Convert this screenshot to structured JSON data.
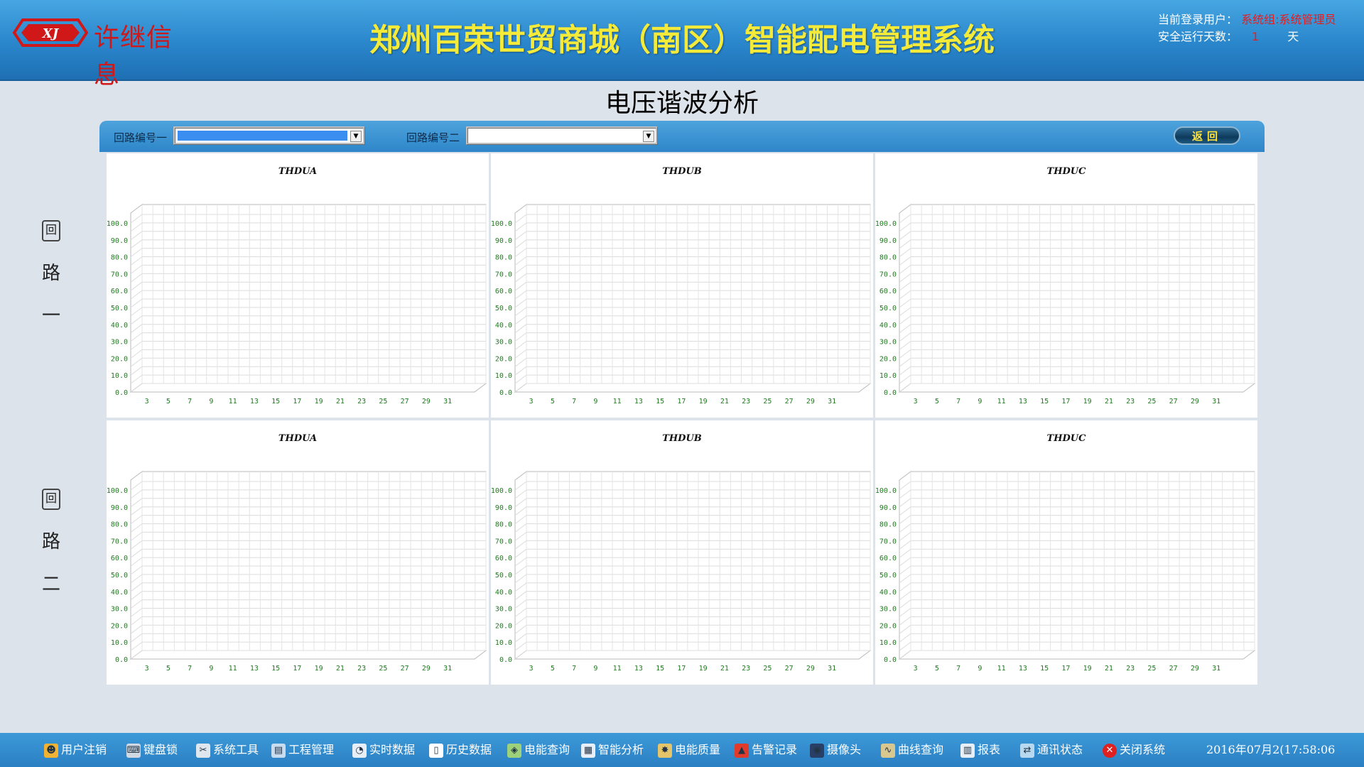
{
  "header": {
    "logo_text": "许继信息",
    "title": "郑州百荣世贸商城（南区）智能配电管理系统",
    "login_label": "当前登录用户：",
    "login_user": "系统组:系统管理员",
    "safe_days_label": "安全运行天数：",
    "safe_days_value": "1",
    "safe_days_unit": "天"
  },
  "page_title": "电压谐波分析",
  "toolbar": {
    "circuit1_label": "回路编号一",
    "circuit2_label": "回路编号二",
    "back_label": "返回"
  },
  "side_labels": {
    "circuit1": [
      "回",
      "路",
      "一"
    ],
    "circuit2": [
      "回",
      "路",
      "二"
    ]
  },
  "chart_data": [
    {
      "type": "bar",
      "title": "THDUA",
      "categories": [
        "3",
        "5",
        "7",
        "9",
        "11",
        "13",
        "15",
        "17",
        "19",
        "21",
        "23",
        "25",
        "27",
        "29",
        "31"
      ],
      "values": [],
      "ylim": [
        0,
        100
      ],
      "yticks": [
        "0.0",
        "10.0",
        "20.0",
        "30.0",
        "40.0",
        "50.0",
        "60.0",
        "70.0",
        "80.0",
        "90.0",
        "100.0"
      ],
      "grid": true
    },
    {
      "type": "bar",
      "title": "THDUB",
      "categories": [
        "3",
        "5",
        "7",
        "9",
        "11",
        "13",
        "15",
        "17",
        "19",
        "21",
        "23",
        "25",
        "27",
        "29",
        "31"
      ],
      "values": [],
      "ylim": [
        0,
        100
      ],
      "yticks": [
        "0.0",
        "10.0",
        "20.0",
        "30.0",
        "40.0",
        "50.0",
        "60.0",
        "70.0",
        "80.0",
        "90.0",
        "100.0"
      ],
      "grid": true
    },
    {
      "type": "bar",
      "title": "THDUC",
      "categories": [
        "3",
        "5",
        "7",
        "9",
        "11",
        "13",
        "15",
        "17",
        "19",
        "21",
        "23",
        "25",
        "27",
        "29",
        "31"
      ],
      "values": [],
      "ylim": [
        0,
        100
      ],
      "yticks": [
        "0.0",
        "10.0",
        "20.0",
        "30.0",
        "40.0",
        "50.0",
        "60.0",
        "70.0",
        "80.0",
        "90.0",
        "100.0"
      ],
      "grid": true
    },
    {
      "type": "bar",
      "title": "THDUA",
      "categories": [
        "3",
        "5",
        "7",
        "9",
        "11",
        "13",
        "15",
        "17",
        "19",
        "21",
        "23",
        "25",
        "27",
        "29",
        "31"
      ],
      "values": [],
      "ylim": [
        0,
        100
      ],
      "yticks": [
        "0.0",
        "10.0",
        "20.0",
        "30.0",
        "40.0",
        "50.0",
        "60.0",
        "70.0",
        "80.0",
        "90.0",
        "100.0"
      ],
      "grid": true
    },
    {
      "type": "bar",
      "title": "THDUB",
      "categories": [
        "3",
        "5",
        "7",
        "9",
        "11",
        "13",
        "15",
        "17",
        "19",
        "21",
        "23",
        "25",
        "27",
        "29",
        "31"
      ],
      "values": [],
      "ylim": [
        0,
        100
      ],
      "yticks": [
        "0.0",
        "10.0",
        "20.0",
        "30.0",
        "40.0",
        "50.0",
        "60.0",
        "70.0",
        "80.0",
        "90.0",
        "100.0"
      ],
      "grid": true
    },
    {
      "type": "bar",
      "title": "THDUC",
      "categories": [
        "3",
        "5",
        "7",
        "9",
        "11",
        "13",
        "15",
        "17",
        "19",
        "21",
        "23",
        "25",
        "27",
        "29",
        "31"
      ],
      "values": [],
      "ylim": [
        0,
        100
      ],
      "yticks": [
        "0.0",
        "10.0",
        "20.0",
        "30.0",
        "40.0",
        "50.0",
        "60.0",
        "70.0",
        "80.0",
        "90.0",
        "100.0"
      ],
      "grid": true
    }
  ],
  "bottom_nav": [
    {
      "label": "用户注销",
      "icon": "user-logout-icon",
      "color": "#f2b233"
    },
    {
      "label": "键盘锁",
      "icon": "keyboard-lock-icon",
      "color": "#cfd8e3"
    },
    {
      "label": "系统工具",
      "icon": "tools-icon",
      "color": "#dfe6ee"
    },
    {
      "label": "工程管理",
      "icon": "project-icon",
      "color": "#c8dcf0"
    },
    {
      "label": "实时数据",
      "icon": "realtime-icon",
      "color": "#e8eef6"
    },
    {
      "label": "历史数据",
      "icon": "history-icon",
      "color": "#ffffff"
    },
    {
      "label": "电能查询",
      "icon": "energy-query-icon",
      "color": "#9ed27a"
    },
    {
      "label": "智能分析",
      "icon": "analysis-icon",
      "color": "#e8eef6"
    },
    {
      "label": "电能质量",
      "icon": "power-quality-icon",
      "color": "#e6c46a"
    },
    {
      "label": "告警记录",
      "icon": "alarm-icon",
      "color": "#e03a2a"
    },
    {
      "label": "摄像头",
      "icon": "camera-icon",
      "color": "#2a3f66"
    },
    {
      "label": "曲线查询",
      "icon": "curve-icon",
      "color": "#d8c890"
    },
    {
      "label": "报表",
      "icon": "report-icon",
      "color": "#e8eef6"
    },
    {
      "label": "通讯状态",
      "icon": "comm-status-icon",
      "color": "#b8d8f0"
    },
    {
      "label": "关闭系统",
      "icon": "close-system-icon",
      "color": "#e02020"
    }
  ],
  "clock": "2016年07月2(17:58:06",
  "colors": {
    "title_yellow": "#f4ea3a",
    "accent_blue": "#2a86cb",
    "tick_green": "#1f7a1f",
    "alert_red": "#e81c1c"
  }
}
